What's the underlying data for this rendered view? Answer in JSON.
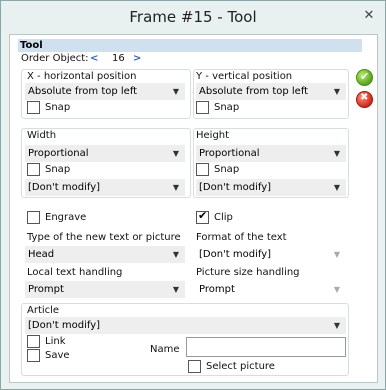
{
  "window": {
    "title": "Frame #15 - Tool",
    "close_glyph": "✕"
  },
  "header": {
    "section": "Tool"
  },
  "order": {
    "label": "Order Object:",
    "prev": "<",
    "value": "16",
    "next": ">"
  },
  "x": {
    "label": "X - horizontal position",
    "value": "Absolute from top left",
    "snap": "Snap",
    "snap_checked": false
  },
  "y": {
    "label": "Y - vertical position",
    "value": "Absolute from top left",
    "snap": "Snap",
    "snap_checked": false
  },
  "width": {
    "label": "Width",
    "value": "Proportional",
    "snap": "Snap",
    "snap_checked": false,
    "modify": "[Don't modify]"
  },
  "height": {
    "label": "Height",
    "value": "Proportional",
    "snap": "Snap",
    "snap_checked": false,
    "modify": "[Don't modify]"
  },
  "engrave": {
    "label": "Engrave",
    "checked": false
  },
  "clip": {
    "label": "Clip",
    "checked": true
  },
  "type_new": {
    "label": "Type of the new text or picture",
    "value": "Head"
  },
  "format_text": {
    "label": "Format of the text",
    "value": "[Don't modify]"
  },
  "local_text": {
    "label": "Local text handling",
    "value": "Prompt"
  },
  "picture_size": {
    "label": "Picture size handling",
    "value": "Prompt"
  },
  "article": {
    "label": "Article",
    "value": "[Don't modify]",
    "link": "Link",
    "save": "Save",
    "name_label": "Name",
    "name_value": "",
    "select_picture": "Select picture"
  },
  "icons": {
    "ok": "check-circle-green",
    "cancel": "x-circle-red"
  },
  "colors": {
    "header_bg": "#cfe1ef",
    "nav": "#2b64c8"
  }
}
